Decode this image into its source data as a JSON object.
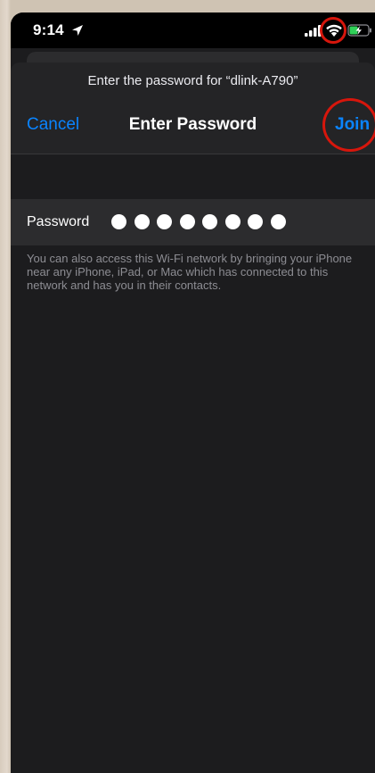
{
  "status_bar": {
    "time": "9:14",
    "icons": [
      "location-arrow-icon",
      "cellular-signal-icon",
      "wifi-icon",
      "battery-charging-icon"
    ]
  },
  "dialog": {
    "prompt": "Enter the password for “dlink-A790”",
    "cancel_label": "Cancel",
    "title": "Enter Password",
    "join_label": "Join"
  },
  "password": {
    "label": "Password",
    "masked_length": 8
  },
  "footnote": "You can also access this Wi-Fi network by bringing your iPhone near any iPhone, iPad, or Mac which has connected to this network and has you in their contacts.",
  "colors": {
    "accent": "#0a84ff",
    "annotation": "#d7160c",
    "background": "#1c1c1e"
  }
}
